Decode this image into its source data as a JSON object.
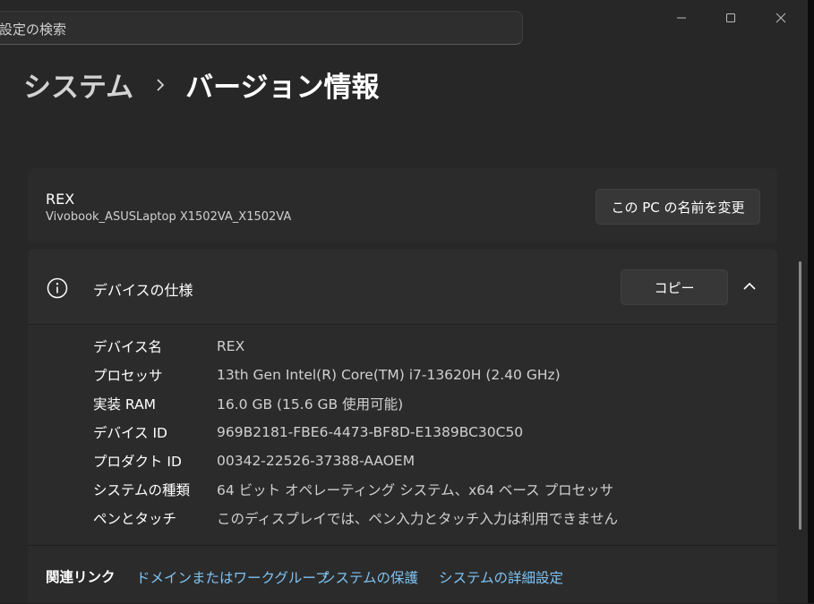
{
  "search": {
    "placeholder": "設定の検索"
  },
  "window_controls": {
    "icons": [
      "minimize-icon",
      "maximize-icon",
      "close-icon"
    ]
  },
  "breadcrumb": {
    "parent": "システム",
    "separator_icon": "chevron-right-icon",
    "current": "バージョン情報"
  },
  "device": {
    "name": "REX",
    "model": "Vivobook_ASUSLaptop X1502VA_X1502VA",
    "rename_button": "この PC の名前を変更"
  },
  "specs": {
    "icon": "info-icon",
    "title": "デバイスの仕様",
    "copy_button": "コピー",
    "collapse_icon": "chevron-up-icon",
    "rows": [
      {
        "label": "デバイス名",
        "value": "REX"
      },
      {
        "label": "プロセッサ",
        "value": "13th Gen Intel(R) Core(TM) i7-13620H (2.40 GHz)"
      },
      {
        "label": "実装 RAM",
        "value": "16.0 GB (15.6 GB 使用可能)"
      },
      {
        "label": "デバイス ID",
        "value": "969B2181-FBE6-4473-BF8D-E1389BC30C50"
      },
      {
        "label": "プロダクト ID",
        "value": "00342-22526-37388-AAOEM"
      },
      {
        "label": "システムの種類",
        "value": "64 ビット オペレーティング システム、x64 ベース プロセッサ"
      },
      {
        "label": "ペンとタッチ",
        "value": "このディスプレイでは、ペン入力とタッチ入力は利用できません"
      }
    ]
  },
  "related": {
    "title": "関連リンク",
    "links": [
      "ドメインまたはワークグループ",
      "システムの保護",
      "システムの詳細設定"
    ]
  },
  "colors": {
    "background": "#272727",
    "card": "#2b2b2b",
    "link": "#7ec3f3",
    "button": "#373737"
  }
}
